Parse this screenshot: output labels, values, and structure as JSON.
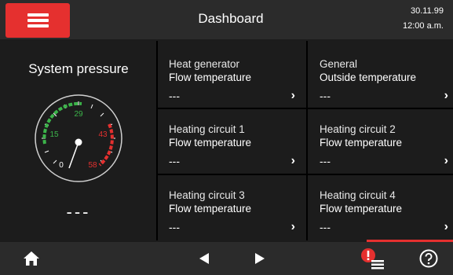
{
  "header": {
    "title": "Dashboard",
    "date": "30.11.99",
    "time": "12:00 a.m."
  },
  "pressure": {
    "title": "System pressure",
    "value": "---",
    "gauge_labels": [
      "0",
      "15",
      "29",
      "43",
      "58"
    ]
  },
  "tiles": [
    {
      "line1": "Heat generator",
      "line2": "Flow temperature",
      "value": "---"
    },
    {
      "line1": "General",
      "line2": "Outside temperature",
      "value": "---"
    },
    {
      "line1": "Heating circuit 1",
      "line2": "Flow temperature",
      "value": "---"
    },
    {
      "line1": "Heating circuit 2",
      "line2": "Flow temperature",
      "value": "---"
    },
    {
      "line1": "Heating circuit 3",
      "line2": "Flow temperature",
      "value": "---"
    },
    {
      "line1": "Heating circuit 4",
      "line2": "Flow temperature",
      "value": "---"
    }
  ],
  "chevron": "›",
  "colors": {
    "accent": "#e5302f",
    "green": "#3cb44a",
    "red": "#e5302f",
    "bar": "#2b2b2b"
  },
  "icons": [
    "menu-icon",
    "home-icon",
    "arrow-left-icon",
    "arrow-right-icon",
    "alarm-list-icon",
    "help-icon"
  ]
}
